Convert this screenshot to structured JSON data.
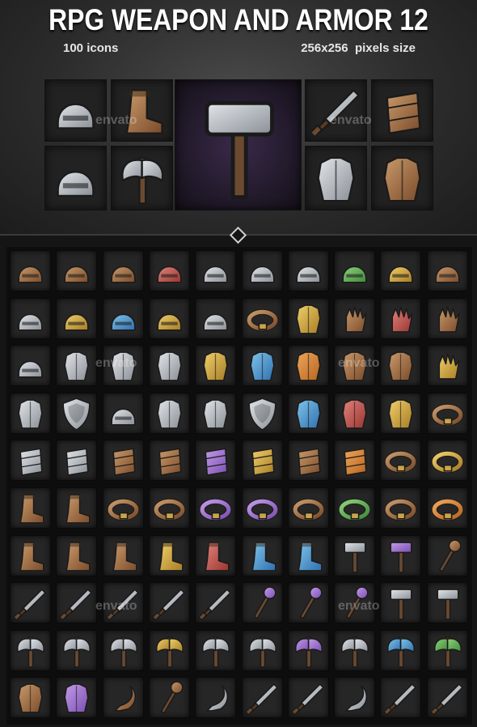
{
  "title": "RPG WEAPON AND ARMOR 12",
  "subtitle_count": "100 icons",
  "subtitle_size": "256x256  pixels size",
  "watermark": "envato",
  "colors": {
    "background": "#151515",
    "title": "#ffffff",
    "subtitle": "#e6e6e6"
  },
  "showcase_icons": [
    "horned-helmet-icon",
    "fur-boot-icon",
    "war-hammer-icon",
    "dagger-icon",
    "bracer-icon",
    "spiked-helmet-icon",
    "double-axe-icon",
    "chest-armor-icon",
    "backpack-scroll-icon"
  ],
  "grid_rows": [
    [
      "feather-hat-icon",
      "hunter-hat-icon",
      "top-hat-icon",
      "pink-helmet-icon",
      "fur-helmet-icon",
      "horned-helmet-icon",
      "goggle-helmet-icon",
      "green-hood-icon",
      "gold-helmet-icon",
      "brown-hood-icon"
    ],
    [
      "visor-helmet-icon",
      "gold-visor-helmet-icon",
      "blue-visor-helmet-icon",
      "gold-knight-helmet-icon",
      "steel-helmet-icon",
      "leather-belt-armor-icon",
      "gold-pants-icon",
      "leather-glove-icon",
      "red-glove-icon",
      "claw-gauntlet-icon"
    ],
    [
      "round-helmet-icon",
      "leather-chest-icon",
      "steel-chest-icon",
      "steel-cuirass-icon",
      "gold-chest-icon",
      "blue-shirt-icon",
      "orange-vest-icon",
      "bronze-armor-icon",
      "scale-armor-icon",
      "yellow-glove-icon"
    ],
    [
      "steel-pauldron-icon",
      "round-shield-icon",
      "kettle-helmet-icon",
      "steel-shoulder-icon",
      "steel-plate-shoulder-icon",
      "kite-shield-icon",
      "blue-pauldron-icon",
      "red-shoulder-icon",
      "gold-shoulder-icon",
      "ring-icon"
    ],
    [
      "greave-icon",
      "steel-greave-icon",
      "wrapped-bracer-icon",
      "studded-bracer-icon",
      "purple-bracer-icon",
      "gold-bracer-icon",
      "leather-bracer-icon",
      "orange-bracer-icon",
      "leather-band-icon",
      "gold-bracelet-icon"
    ],
    [
      "leather-leg-icon",
      "cowboy-boot-icon",
      "tooth-necklace-icon",
      "pocket-watch-icon",
      "purple-belt-icon",
      "purple-sash-icon",
      "brown-strap-icon",
      "green-belt-icon",
      "horseshoe-belt-icon",
      "orange-belt-icon"
    ],
    [
      "moccasin-icon",
      "brown-boot-icon",
      "fur-boot-icon",
      "yellow-boot-icon",
      "red-boot-icon",
      "teal-boot-icon",
      "cyan-boot-icon",
      "mace-icon",
      "purple-club-icon",
      "slingshot-icon"
    ],
    [
      "short-sword-icon",
      "long-sword-icon",
      "broad-sword-icon",
      "cross-sword-icon",
      "spear-icon",
      "purple-staff-icon",
      "purple-wand-icon",
      "violet-lantern-icon",
      "stone-hammer-icon",
      "war-hammer-icon"
    ],
    [
      "cleaver-icon",
      "double-axe-icon",
      "battle-axe-icon",
      "gold-axe-icon",
      "steel-axe-icon",
      "pickaxe-icon",
      "purple-axe-icon",
      "crescent-axe-icon",
      "cyan-axe-icon",
      "green-axe-icon"
    ],
    [
      "backpack-icon",
      "purple-pouch-icon",
      "horn-icon",
      "oar-icon",
      "anchor-icon",
      "machete-icon",
      "serrated-blade-icon",
      "sickle-icon",
      "throwing-knife-icon",
      "ornate-dagger-icon"
    ]
  ]
}
